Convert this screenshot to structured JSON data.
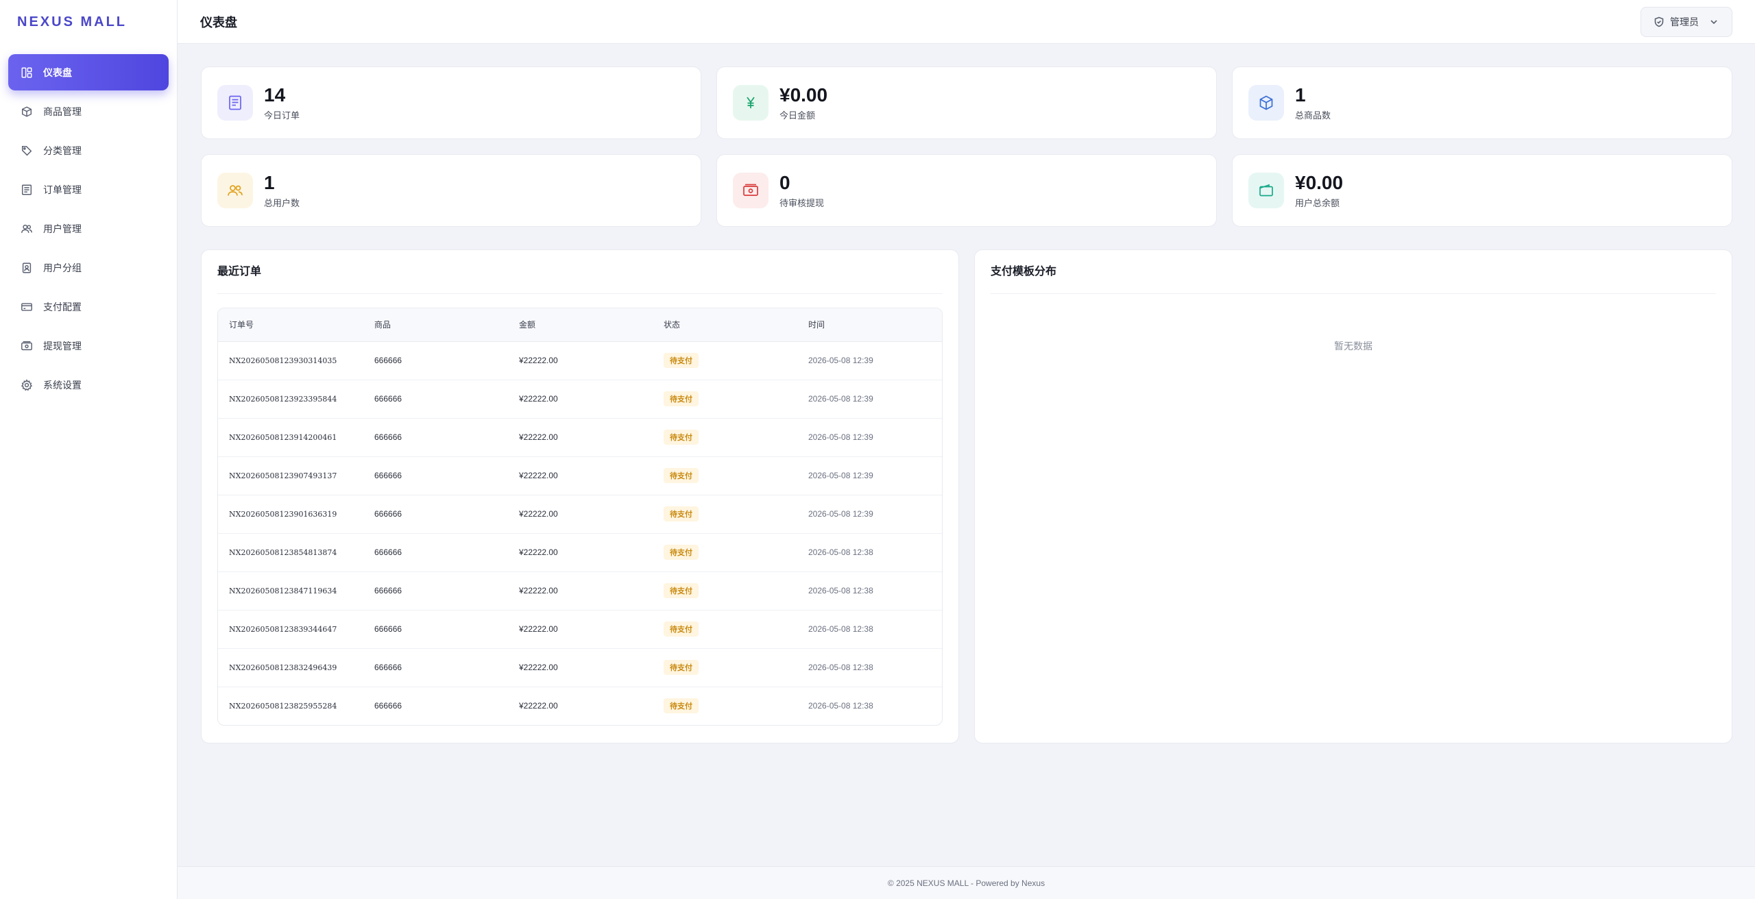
{
  "brand": "NEXUS MALL",
  "sidebar": {
    "items": [
      {
        "label": "仪表盘",
        "icon": "dashboard-icon",
        "active": true
      },
      {
        "label": "商品管理",
        "icon": "cube-icon"
      },
      {
        "label": "分类管理",
        "icon": "tag-icon"
      },
      {
        "label": "订单管理",
        "icon": "order-list-icon"
      },
      {
        "label": "用户管理",
        "icon": "users-icon"
      },
      {
        "label": "用户分组",
        "icon": "user-group-icon"
      },
      {
        "label": "支付配置",
        "icon": "credit-card-icon"
      },
      {
        "label": "提现管理",
        "icon": "cash-icon"
      },
      {
        "label": "系统设置",
        "icon": "gear-icon"
      }
    ]
  },
  "header": {
    "title": "仪表盘",
    "admin_label": "管理员"
  },
  "stats": [
    {
      "value": "14",
      "label": "今日订单",
      "icon": "document-icon",
      "color": "#6b63ef",
      "bg": "#efeefd"
    },
    {
      "value": "¥0.00",
      "label": "今日金额",
      "icon": "yen-icon",
      "color": "#16a36b",
      "bg": "#e7f7ef"
    },
    {
      "value": "1",
      "label": "总商品数",
      "icon": "cube-icon",
      "color": "#3a6fd6",
      "bg": "#eaf0fc"
    },
    {
      "value": "1",
      "label": "总用户数",
      "icon": "users-icon",
      "color": "#e0a21c",
      "bg": "#fdf5e3"
    },
    {
      "value": "0",
      "label": "待审核提现",
      "icon": "cash-icon",
      "color": "#d93b3b",
      "bg": "#fdecec"
    },
    {
      "value": "¥0.00",
      "label": "用户总余额",
      "icon": "wallet-icon",
      "color": "#19a98a",
      "bg": "#e6f7f3"
    }
  ],
  "recent_orders": {
    "title": "最近订单",
    "columns": [
      "订单号",
      "商品",
      "金额",
      "状态",
      "时间"
    ],
    "rows": [
      [
        "NX20260508123930314035",
        "666666",
        "¥22222.00",
        "待支付",
        "2026-05-08 12:39"
      ],
      [
        "NX20260508123923395844",
        "666666",
        "¥22222.00",
        "待支付",
        "2026-05-08 12:39"
      ],
      [
        "NX20260508123914200461",
        "666666",
        "¥22222.00",
        "待支付",
        "2026-05-08 12:39"
      ],
      [
        "NX20260508123907493137",
        "666666",
        "¥22222.00",
        "待支付",
        "2026-05-08 12:39"
      ],
      [
        "NX20260508123901636319",
        "666666",
        "¥22222.00",
        "待支付",
        "2026-05-08 12:39"
      ],
      [
        "NX20260508123854813874",
        "666666",
        "¥22222.00",
        "待支付",
        "2026-05-08 12:38"
      ],
      [
        "NX20260508123847119634",
        "666666",
        "¥22222.00",
        "待支付",
        "2026-05-08 12:38"
      ],
      [
        "NX20260508123839344647",
        "666666",
        "¥22222.00",
        "待支付",
        "2026-05-08 12:38"
      ],
      [
        "NX20260508123832496439",
        "666666",
        "¥22222.00",
        "待支付",
        "2026-05-08 12:38"
      ],
      [
        "NX20260508123825955284",
        "666666",
        "¥22222.00",
        "待支付",
        "2026-05-08 12:38"
      ]
    ]
  },
  "payment_distribution": {
    "title": "支付模板分布",
    "empty_text": "暂无数据"
  },
  "footer": "© 2025 NEXUS MALL - Powered by Nexus"
}
